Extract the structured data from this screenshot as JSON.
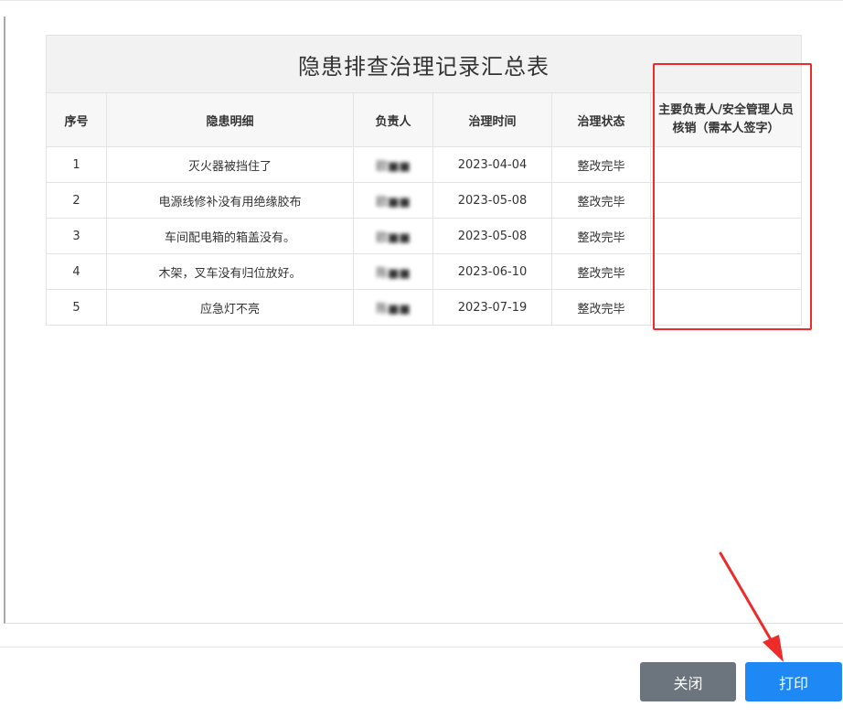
{
  "report": {
    "title": "隐患排查治理记录汇总表",
    "columns": [
      "序号",
      "隐患明细",
      "负责人",
      "治理时间",
      "治理状态",
      "主要负责人/安全管理人员核销（需本人签字）"
    ],
    "rows": [
      {
        "no": "1",
        "detail": "灭火器被挡住了",
        "person": "欧■■",
        "date": "2023-04-04",
        "status": "整改完毕",
        "sign": ""
      },
      {
        "no": "2",
        "detail": "电源线修补没有用绝缘胶布",
        "person": "欧■■",
        "date": "2023-05-08",
        "status": "整改完毕",
        "sign": ""
      },
      {
        "no": "3",
        "detail": "车间配电箱的箱盖没有。",
        "person": "欧■■",
        "date": "2023-05-08",
        "status": "整改完毕",
        "sign": ""
      },
      {
        "no": "4",
        "detail": "木架，叉车没有归位放好。",
        "person": "陈■■",
        "date": "2023-06-10",
        "status": "整改完毕",
        "sign": ""
      },
      {
        "no": "5",
        "detail": "应急灯不亮",
        "person": "陈■■",
        "date": "2023-07-19",
        "status": "整改完毕",
        "sign": ""
      }
    ]
  },
  "buttons": {
    "close_label": "关闭",
    "print_label": "打印"
  },
  "colors": {
    "highlight": "#ee2b2b",
    "status_ok": "#2e8b2e",
    "print_button": "#1e88f5",
    "close_button": "#6c757d"
  }
}
